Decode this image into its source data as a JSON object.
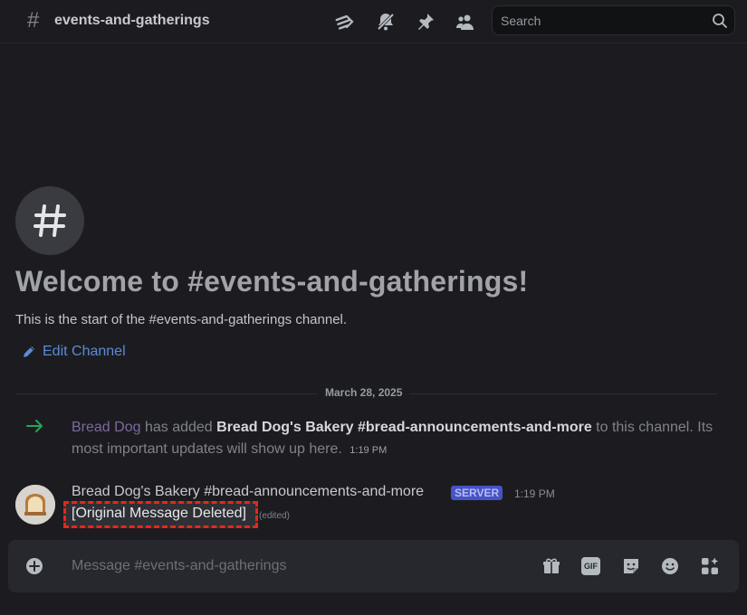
{
  "header": {
    "hash_symbol": "#",
    "channel_name": "events-and-gatherings",
    "icons": [
      "threads-icon",
      "notification-muted-icon",
      "pin-icon",
      "members-icon"
    ],
    "search_placeholder": "Search"
  },
  "welcome": {
    "hash_symbol": "#",
    "title": "Welcome to #events-and-gatherings!",
    "subtitle": "This is the start of the #events-and-gatherings channel.",
    "edit_label": "Edit Channel"
  },
  "date_divider": "March 28, 2025",
  "system_message": {
    "actor": "Bread Dog",
    "text_added": "has added",
    "target": "Bread Dog's Bakery #bread-announcements-and-more",
    "text_rest": "to this channel. Its most important updates will show up here.",
    "time": "1:19 PM"
  },
  "message": {
    "author": "Bread Dog's Bakery #bread-announcements-and-more",
    "badge": "SERVER",
    "time": "1:19 PM",
    "content": "[Original Message Deleted]",
    "edited_label": "(edited)"
  },
  "composer": {
    "placeholder": "Message #events-and-gatherings",
    "gif_label": "GIF"
  },
  "colors": {
    "background": "#1c1c20",
    "accent_link": "#5b8bd6",
    "badge": "#4752c4",
    "highlight_outline": "#e3281a",
    "join_arrow": "#23a55a"
  }
}
